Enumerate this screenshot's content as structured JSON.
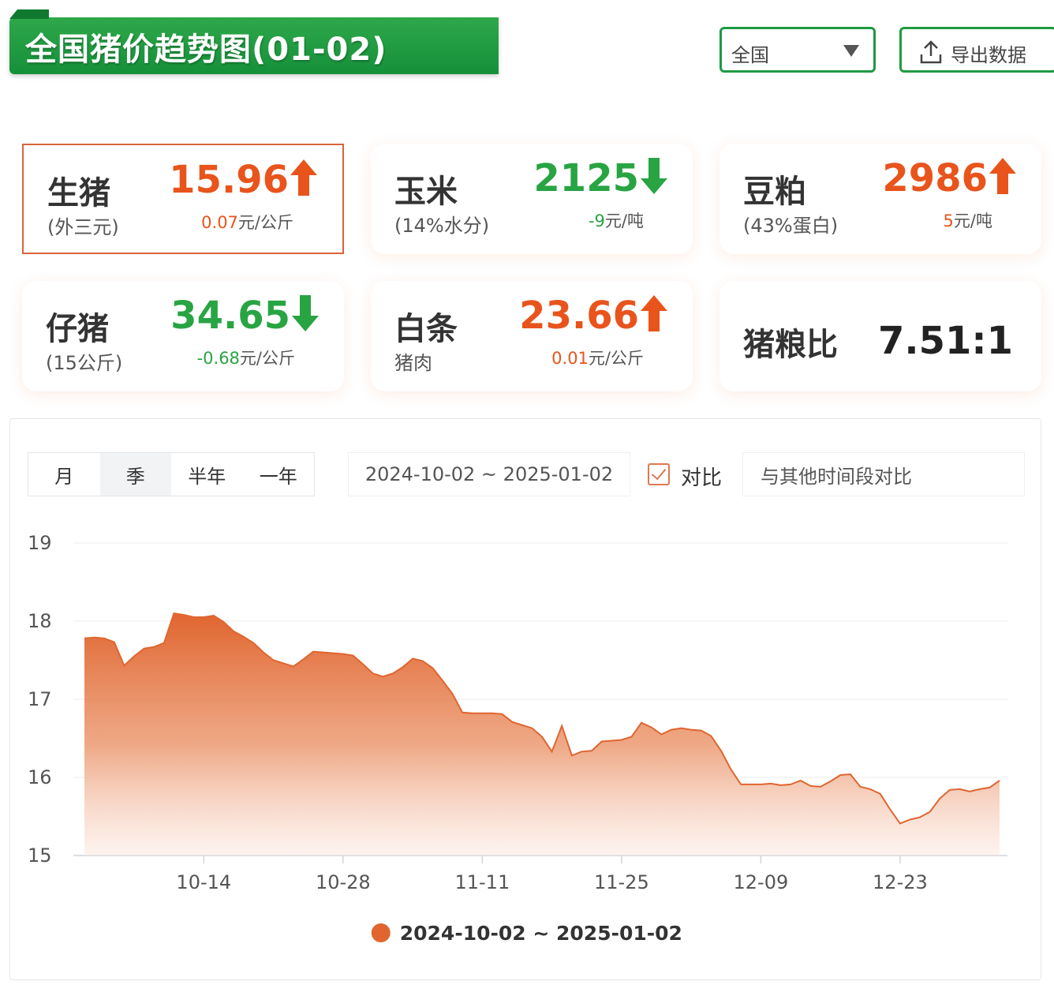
{
  "header": {
    "title": "全国猪价趋势图(01-02)",
    "region": "全国",
    "export_label": "导出数据"
  },
  "cards": [
    {
      "name": "生猪",
      "sub": "(外三元)",
      "value": "15.96",
      "direction": "up",
      "change": "0.07",
      "unit": "元/公斤",
      "selected": true
    },
    {
      "name": "玉米",
      "sub": "(14%水分)",
      "value": "2125",
      "direction": "down",
      "change": "-9",
      "unit": "元/吨",
      "selected": false
    },
    {
      "name": "豆粕",
      "sub": "(43%蛋白)",
      "value": "2986",
      "direction": "up",
      "change": "5",
      "unit": "元/吨",
      "selected": false
    },
    {
      "name": "仔猪",
      "sub": "(15公斤)",
      "value": "34.65",
      "direction": "down",
      "change": "-0.68",
      "unit": "元/公斤",
      "selected": false
    },
    {
      "name": "白条",
      "sub": "猪肉",
      "value": "23.66",
      "direction": "up",
      "change": "0.01",
      "unit": "元/公斤",
      "selected": false
    }
  ],
  "ratio": {
    "name": "猪粮比",
    "value": "7.51:1"
  },
  "controls": {
    "range_tabs": [
      "月",
      "季",
      "半年",
      "一年"
    ],
    "active_tab": 1,
    "date_range": "2024-10-02 ~ 2025-01-02",
    "compare_label": "对比",
    "compare_placeholder": "与其他时间段对比"
  },
  "colors": {
    "up": "#e8541c",
    "down": "#28a443",
    "brand_green": "#1d9a42",
    "series": "#e0652f"
  },
  "chart_data": {
    "type": "area",
    "title": "",
    "xlabel": "",
    "ylabel": "",
    "x_start": "2024-10-02",
    "x_end": "2025-01-02",
    "x_ticks": [
      "10-14",
      "10-28",
      "11-11",
      "11-25",
      "12-09",
      "12-23"
    ],
    "x_tick_dates": [
      "2024-10-14",
      "2024-10-28",
      "2024-11-11",
      "2024-11-25",
      "2024-12-09",
      "2024-12-23"
    ],
    "y_ticks": [
      15,
      16,
      17,
      18,
      19
    ],
    "ylim": [
      15,
      19
    ],
    "grid": true,
    "legend_position": "bottom-center",
    "series": [
      {
        "name": "2024-10-02 ~ 2025-01-02",
        "points": [
          [
            "2024-10-02",
            17.78
          ],
          [
            "2024-10-03",
            17.79
          ],
          [
            "2024-10-04",
            17.78
          ],
          [
            "2024-10-05",
            17.73
          ],
          [
            "2024-10-06",
            17.43
          ],
          [
            "2024-10-07",
            17.55
          ],
          [
            "2024-10-08",
            17.65
          ],
          [
            "2024-10-09",
            17.67
          ],
          [
            "2024-10-10",
            17.72
          ],
          [
            "2024-10-11",
            18.1
          ],
          [
            "2024-10-12",
            18.08
          ],
          [
            "2024-10-13",
            18.05
          ],
          [
            "2024-10-14",
            18.05
          ],
          [
            "2024-10-15",
            18.07
          ],
          [
            "2024-10-16",
            17.99
          ],
          [
            "2024-10-17",
            17.87
          ],
          [
            "2024-10-18",
            17.8
          ],
          [
            "2024-10-19",
            17.72
          ],
          [
            "2024-10-20",
            17.6
          ],
          [
            "2024-10-21",
            17.5
          ],
          [
            "2024-10-22",
            17.46
          ],
          [
            "2024-10-23",
            17.42
          ],
          [
            "2024-10-24",
            17.51
          ],
          [
            "2024-10-25",
            17.61
          ],
          [
            "2024-10-26",
            17.6
          ],
          [
            "2024-10-27",
            17.59
          ],
          [
            "2024-10-28",
            17.58
          ],
          [
            "2024-10-29",
            17.56
          ],
          [
            "2024-10-30",
            17.45
          ],
          [
            "2024-10-31",
            17.33
          ],
          [
            "2024-11-01",
            17.29
          ],
          [
            "2024-11-02",
            17.33
          ],
          [
            "2024-11-03",
            17.41
          ],
          [
            "2024-11-04",
            17.52
          ],
          [
            "2024-11-05",
            17.49
          ],
          [
            "2024-11-06",
            17.4
          ],
          [
            "2024-11-07",
            17.24
          ],
          [
            "2024-11-08",
            17.07
          ],
          [
            "2024-11-09",
            16.83
          ],
          [
            "2024-11-10",
            16.82
          ],
          [
            "2024-11-11",
            16.82
          ],
          [
            "2024-11-12",
            16.82
          ],
          [
            "2024-11-13",
            16.81
          ],
          [
            "2024-11-14",
            16.71
          ],
          [
            "2024-11-15",
            16.67
          ],
          [
            "2024-11-16",
            16.63
          ],
          [
            "2024-11-17",
            16.52
          ],
          [
            "2024-11-18",
            16.33
          ],
          [
            "2024-11-19",
            16.66
          ],
          [
            "2024-11-20",
            16.28
          ],
          [
            "2024-11-21",
            16.33
          ],
          [
            "2024-11-22",
            16.34
          ],
          [
            "2024-11-23",
            16.46
          ],
          [
            "2024-11-24",
            16.47
          ],
          [
            "2024-11-25",
            16.48
          ],
          [
            "2024-11-26",
            16.52
          ],
          [
            "2024-11-27",
            16.7
          ],
          [
            "2024-11-28",
            16.64
          ],
          [
            "2024-11-29",
            16.55
          ],
          [
            "2024-11-30",
            16.61
          ],
          [
            "2024-12-01",
            16.63
          ],
          [
            "2024-12-02",
            16.61
          ],
          [
            "2024-12-03",
            16.6
          ],
          [
            "2024-12-04",
            16.53
          ],
          [
            "2024-12-05",
            16.34
          ],
          [
            "2024-12-06",
            16.1
          ],
          [
            "2024-12-07",
            15.91
          ],
          [
            "2024-12-08",
            15.91
          ],
          [
            "2024-12-09",
            15.91
          ],
          [
            "2024-12-10",
            15.92
          ],
          [
            "2024-12-11",
            15.9
          ],
          [
            "2024-12-12",
            15.91
          ],
          [
            "2024-12-13",
            15.96
          ],
          [
            "2024-12-14",
            15.89
          ],
          [
            "2024-12-15",
            15.88
          ],
          [
            "2024-12-16",
            15.95
          ],
          [
            "2024-12-17",
            16.03
          ],
          [
            "2024-12-18",
            16.04
          ],
          [
            "2024-12-19",
            15.88
          ],
          [
            "2024-12-20",
            15.85
          ],
          [
            "2024-12-21",
            15.79
          ],
          [
            "2024-12-22",
            15.59
          ],
          [
            "2024-12-23",
            15.41
          ],
          [
            "2024-12-24",
            15.46
          ],
          [
            "2024-12-25",
            15.49
          ],
          [
            "2024-12-26",
            15.56
          ],
          [
            "2024-12-27",
            15.73
          ],
          [
            "2024-12-28",
            15.84
          ],
          [
            "2024-12-29",
            15.85
          ],
          [
            "2024-12-30",
            15.82
          ],
          [
            "2024-12-31",
            15.85
          ],
          [
            "2025-01-01",
            15.87
          ],
          [
            "2025-01-02",
            15.96
          ]
        ]
      }
    ]
  }
}
